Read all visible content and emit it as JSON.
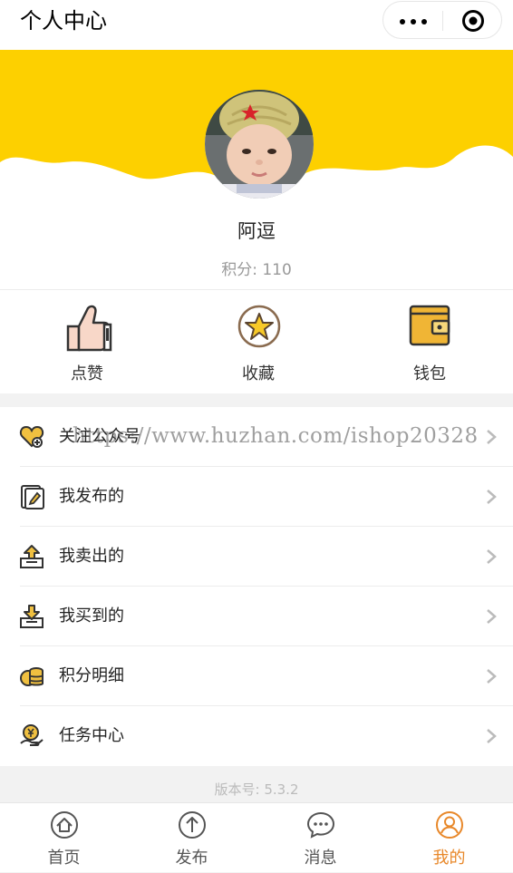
{
  "header": {
    "title": "个人中心"
  },
  "user": {
    "nickname": "阿逗",
    "points_label": "积分: 110"
  },
  "actions": [
    {
      "label": "点赞",
      "icon": "thumbs-up-icon"
    },
    {
      "label": "收藏",
      "icon": "star-icon"
    },
    {
      "label": "钱包",
      "icon": "wallet-icon"
    }
  ],
  "menu": [
    {
      "label": "关注公众号",
      "icon": "heart-icon"
    },
    {
      "label": "我发布的",
      "icon": "publish-doc-icon"
    },
    {
      "label": "我卖出的",
      "icon": "sold-box-icon"
    },
    {
      "label": "我买到的",
      "icon": "bought-box-icon"
    },
    {
      "label": "积分明细",
      "icon": "coins-icon"
    },
    {
      "label": "任务中心",
      "icon": "task-hand-icon"
    }
  ],
  "watermark": "https://www.huzhan.com/ishop20328",
  "footer": {
    "version": "版本号: 5.3.2"
  },
  "tabbar": [
    {
      "label": "首页",
      "icon": "home-icon",
      "active": false
    },
    {
      "label": "发布",
      "icon": "upload-icon",
      "active": false
    },
    {
      "label": "消息",
      "icon": "message-icon",
      "active": false
    },
    {
      "label": "我的",
      "icon": "user-icon",
      "active": true
    }
  ],
  "colors": {
    "accent": "#fdd000",
    "tab_active": "#e8882a",
    "text": "#222222",
    "muted": "#999999"
  }
}
